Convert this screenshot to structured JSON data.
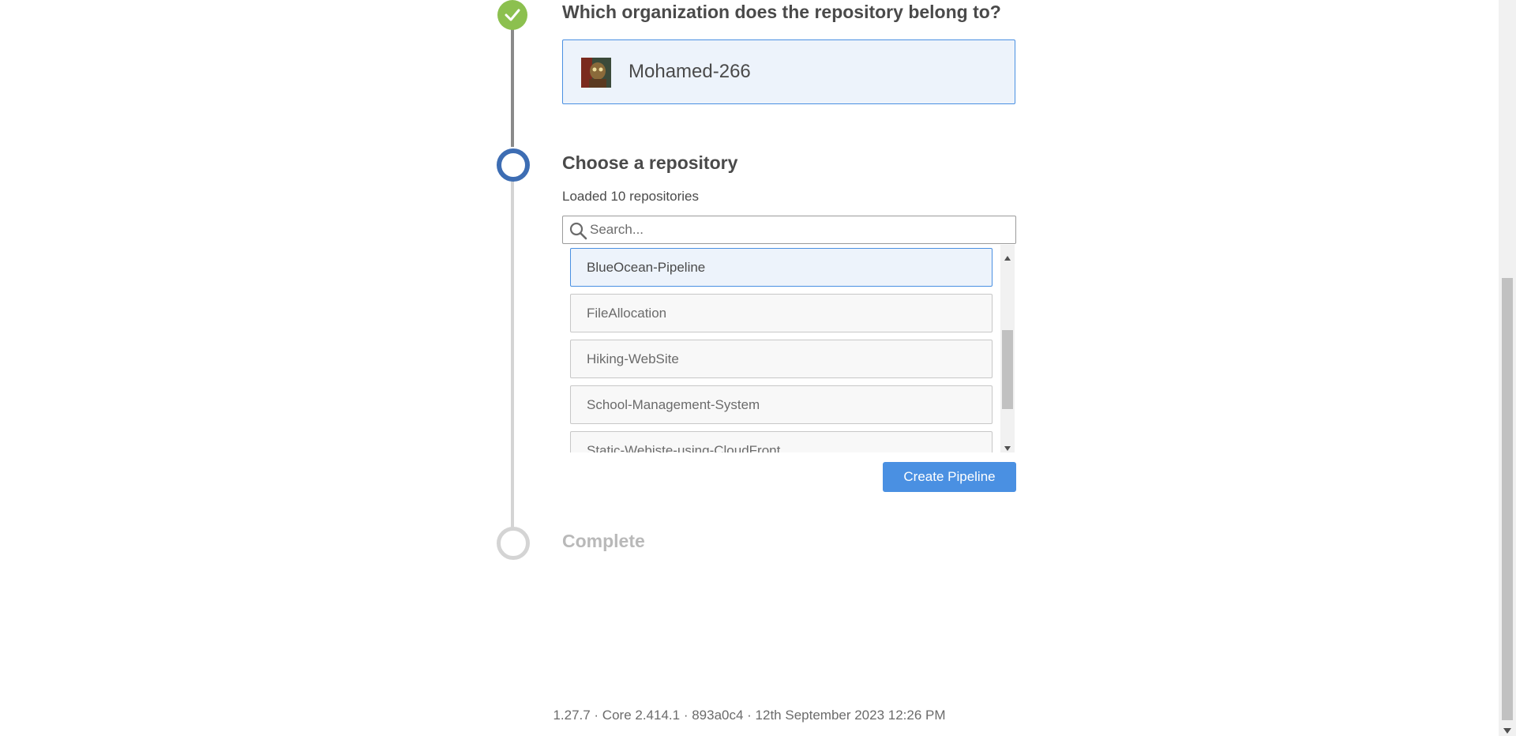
{
  "steps": {
    "org": {
      "title": "Which organization does the repository belong to?",
      "selected_org": "Mohamed-266"
    },
    "repo": {
      "title": "Choose a repository",
      "loaded_text": "Loaded 10 repositories",
      "search_placeholder": "Search...",
      "repositories": [
        {
          "name": "BlueOcean-Pipeline",
          "selected": true
        },
        {
          "name": "FileAllocation",
          "selected": false
        },
        {
          "name": "Hiking-WebSite",
          "selected": false
        },
        {
          "name": "School-Management-System",
          "selected": false
        },
        {
          "name": "Static-Webiste-using-CloudFront",
          "selected": false
        }
      ],
      "create_button_label": "Create Pipeline"
    },
    "complete": {
      "title": "Complete"
    }
  },
  "footer": {
    "version_text": "1.27.7 · Core 2.414.1 · 893a0c4 · 12th September 2023 12:26 PM"
  },
  "colors": {
    "accent": "#4a90e2",
    "step_done": "#8cc04f",
    "step_active": "#3d6db3",
    "step_pending": "#d4d4d4"
  }
}
